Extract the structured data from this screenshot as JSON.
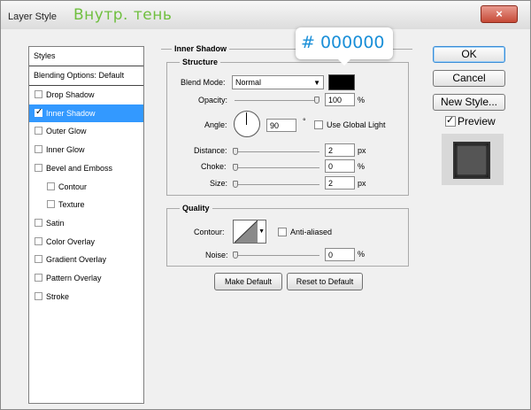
{
  "window": {
    "title": "Layer Style",
    "title_extra": "Внутр. тень",
    "close_icon": "×"
  },
  "styles_panel": {
    "header": "Styles",
    "blending": "Blending Options: Default",
    "items": [
      {
        "label": "Drop Shadow",
        "checked": false,
        "selected": false,
        "indent": false
      },
      {
        "label": "Inner Shadow",
        "checked": true,
        "selected": true,
        "indent": false
      },
      {
        "label": "Outer Glow",
        "checked": false,
        "selected": false,
        "indent": false
      },
      {
        "label": "Inner Glow",
        "checked": false,
        "selected": false,
        "indent": false
      },
      {
        "label": "Bevel and Emboss",
        "checked": false,
        "selected": false,
        "indent": false
      },
      {
        "label": "Contour",
        "checked": false,
        "selected": false,
        "indent": true
      },
      {
        "label": "Texture",
        "checked": false,
        "selected": false,
        "indent": true
      },
      {
        "label": "Satin",
        "checked": false,
        "selected": false,
        "indent": false
      },
      {
        "label": "Color Overlay",
        "checked": false,
        "selected": false,
        "indent": false
      },
      {
        "label": "Gradient Overlay",
        "checked": false,
        "selected": false,
        "indent": false
      },
      {
        "label": "Pattern Overlay",
        "checked": false,
        "selected": false,
        "indent": false
      },
      {
        "label": "Stroke",
        "checked": false,
        "selected": false,
        "indent": false
      }
    ]
  },
  "inner_shadow": {
    "title": "Inner Shadow",
    "structure": {
      "title": "Structure",
      "blend_mode_label": "Blend Mode:",
      "blend_mode_value": "Normal",
      "color_hex": "# 000000",
      "color": "#000000",
      "opacity_label": "Opacity:",
      "opacity_value": "100",
      "opacity_unit": "%",
      "opacity_level": 1.0,
      "angle_label": "Angle:",
      "angle_value": "90",
      "angle_unit": "°",
      "use_global_light": "Use Global Light",
      "distance_label": "Distance:",
      "distance_value": "2",
      "distance_unit": "px",
      "distance_level": 0.0,
      "choke_label": "Choke:",
      "choke_value": "0",
      "choke_unit": "%",
      "choke_level": 0.0,
      "size_label": "Size:",
      "size_value": "2",
      "size_unit": "px",
      "size_level": 0.0
    },
    "quality": {
      "title": "Quality",
      "contour_label": "Contour:",
      "anti_aliased": "Anti-aliased",
      "noise_label": "Noise:",
      "noise_value": "0",
      "noise_unit": "%",
      "noise_level": 0.0
    },
    "make_default": "Make Default",
    "reset_default": "Reset to Default"
  },
  "right": {
    "ok": "OK",
    "cancel": "Cancel",
    "new_style": "New Style...",
    "preview": "Preview",
    "preview_checked": true
  }
}
